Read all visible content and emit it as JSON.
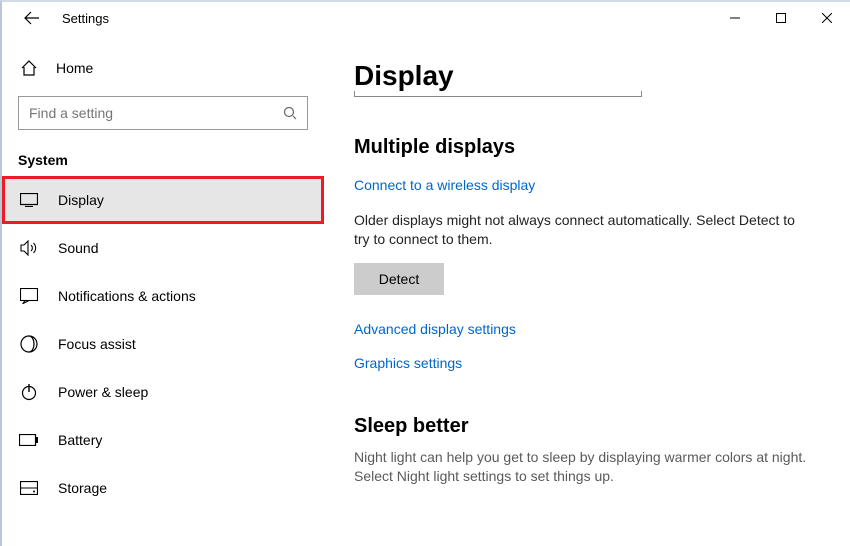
{
  "window": {
    "title": "Settings"
  },
  "sidebar": {
    "home_label": "Home",
    "search_placeholder": "Find a setting",
    "category_label": "System",
    "items": [
      {
        "label": "Display"
      },
      {
        "label": "Sound"
      },
      {
        "label": "Notifications & actions"
      },
      {
        "label": "Focus assist"
      },
      {
        "label": "Power & sleep"
      },
      {
        "label": "Battery"
      },
      {
        "label": "Storage"
      }
    ]
  },
  "main": {
    "title": "Display",
    "multiple_displays_heading": "Multiple displays",
    "wireless_link": "Connect to a wireless display",
    "detect_paragraph": "Older displays might not always connect automatically. Select Detect to try to connect to them.",
    "detect_button": "Detect",
    "advanced_link": "Advanced display settings",
    "graphics_link": "Graphics settings",
    "sleep_heading": "Sleep better",
    "sleep_paragraph": "Night light can help you get to sleep by displaying warmer colors at night. Select Night light settings to set things up."
  }
}
